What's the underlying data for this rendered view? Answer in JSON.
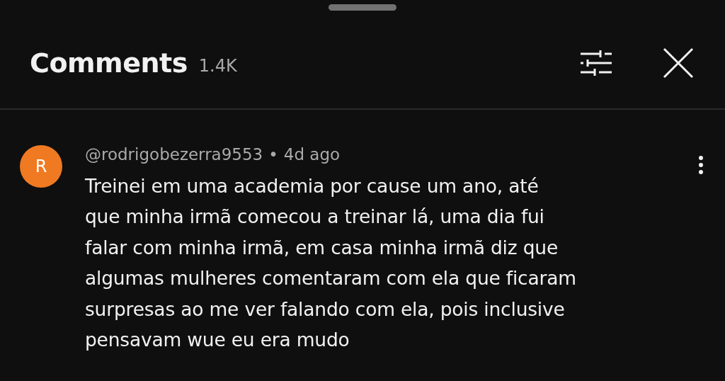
{
  "header": {
    "title": "Comments",
    "count": "1.4K"
  },
  "comments": [
    {
      "avatar_letter": "R",
      "color": "#ef7a22",
      "author": "@rodrigobezerra9553",
      "separator": "•",
      "time": "4d ago",
      "text": "Treinei em uma academia por cause um ano, até\nque minha irmã comecou a treinar lá, uma dia fui\nfalar com minha irmã, em casa minha irmã diz que\nalgumas mulheres comentaram com ela que ficaram\nsurpresas ao me ver falando com ela, pois inclusive\npensavam wue eu era mudo"
    }
  ]
}
